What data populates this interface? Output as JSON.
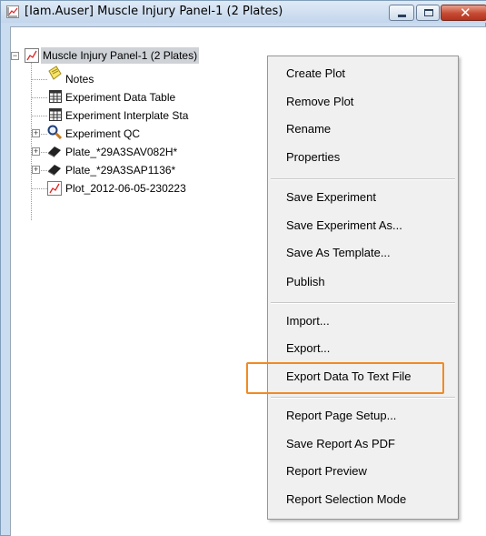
{
  "window": {
    "title": "[Iam.Auser] Muscle Injury Panel-1 (2 Plates)",
    "controls": {
      "minimize": "minimize",
      "maximize": "maximize",
      "close": "close"
    }
  },
  "tree": {
    "root": {
      "label": "Muscle Injury Panel-1 (2 Plates)",
      "icon": "plot-icon",
      "expanded": true
    },
    "children": [
      {
        "label": "Notes",
        "icon": "notes-icon",
        "expandable": false
      },
      {
        "label": "Experiment Data Table",
        "icon": "table-icon",
        "expandable": false
      },
      {
        "label": "Experiment Interplate Sta",
        "icon": "table-icon",
        "expandable": false
      },
      {
        "label": "Experiment QC",
        "icon": "magnifier-icon",
        "expandable": true
      },
      {
        "label": "Plate_*29A3SAV082H*",
        "icon": "plate-icon",
        "expandable": true
      },
      {
        "label": "Plate_*29A3SAP1136*",
        "icon": "plate-icon",
        "expandable": true
      },
      {
        "label": "Plot_2012-06-05-230223",
        "icon": "plot-icon",
        "expandable": false
      }
    ]
  },
  "context_menu": {
    "groups": [
      [
        "Create Plot",
        "Remove Plot",
        "Rename",
        "Properties"
      ],
      [
        "Save Experiment",
        "Save Experiment As...",
        "Save As Template...",
        "Publish"
      ],
      [
        "Import...",
        "Export...",
        "Export Data To Text File"
      ],
      [
        "Report Page Setup...",
        "Save Report As PDF",
        "Report Preview",
        "Report Selection Mode"
      ]
    ],
    "highlighted_item": "Export Data To Text File",
    "highlight_color": "#f08a24"
  }
}
